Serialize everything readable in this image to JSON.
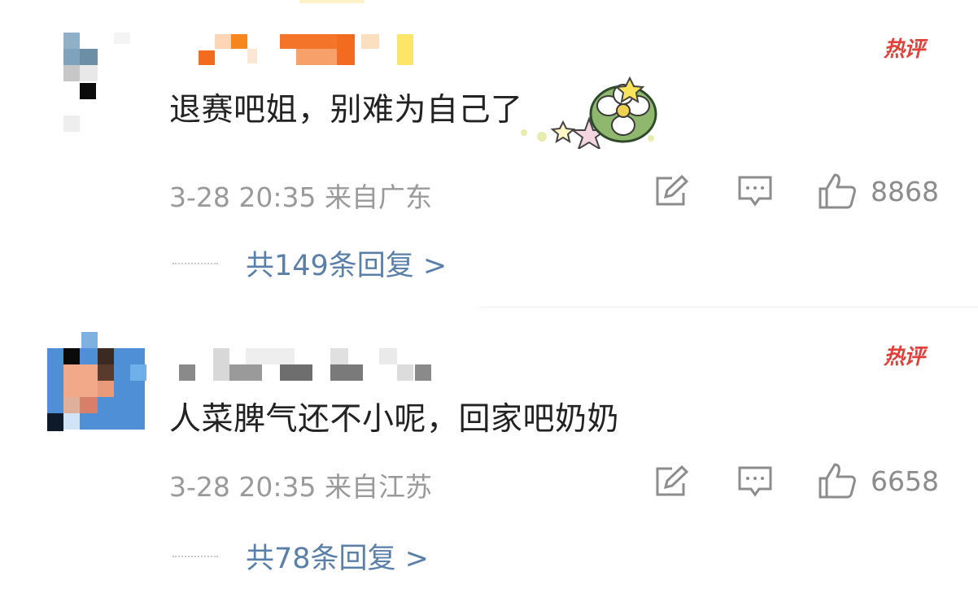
{
  "comments": [
    {
      "badge": "热评",
      "text": "退赛吧姐，别难为自己了",
      "time_location": "3-28 20:35 来自广东",
      "likes": "8868",
      "replies_label": "共149条回复 >",
      "icons": [
        "share-edit-icon",
        "comment-icon",
        "thumbs-up-icon"
      ]
    },
    {
      "badge": "热评",
      "text": "人菜脾气还不小呢，回家吧奶奶",
      "time_location": "3-28 20:35 来自江苏",
      "likes": "6658",
      "replies_label": "共78条回复 >",
      "icons": [
        "share-edit-icon",
        "comment-icon",
        "thumbs-up-icon"
      ]
    }
  ],
  "colors": {
    "hot_badge": "#e0413a",
    "reply_link": "#5a7fa8",
    "meta_text": "#9a9a9a",
    "body_text": "#222222"
  }
}
